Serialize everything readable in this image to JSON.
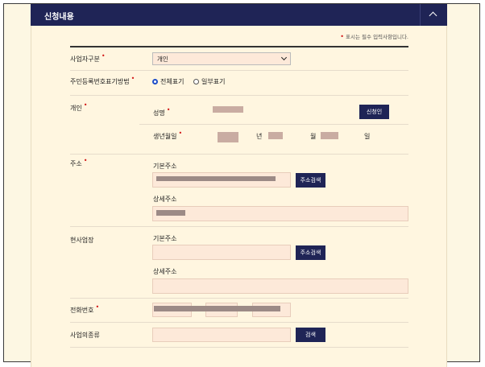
{
  "header": {
    "title": "신청내용",
    "toggle_icon": "chevron-up-icon"
  },
  "note": {
    "text": "표시는 필수 입력사항입니다."
  },
  "business_type": {
    "label": "사업자구분",
    "selected": "개인"
  },
  "id_display": {
    "label": "주민등록번호표기방법",
    "options": [
      "전체표기",
      "일부표기"
    ],
    "selected": "전체표기"
  },
  "person": {
    "label": "개인",
    "name_label": "성명",
    "applicant_button": "신청인",
    "birth_label": "생년월일",
    "year_unit": "년",
    "month_unit": "월",
    "day_unit": "일"
  },
  "address": {
    "label": "주소",
    "basic_label": "기본주소",
    "search_button": "주소검색",
    "detail_label": "상세주소"
  },
  "workplace": {
    "label": "현사업장",
    "basic_label": "기본주소",
    "search_button": "주소검색",
    "detail_label": "상세주소"
  },
  "phone": {
    "label": "전화번호"
  },
  "business_kind": {
    "label": "사업의종류",
    "search_button": "검색"
  },
  "colors": {
    "header_bg": "#1f2456",
    "input_bg": "#fde9d9",
    "required": "#d21818"
  }
}
